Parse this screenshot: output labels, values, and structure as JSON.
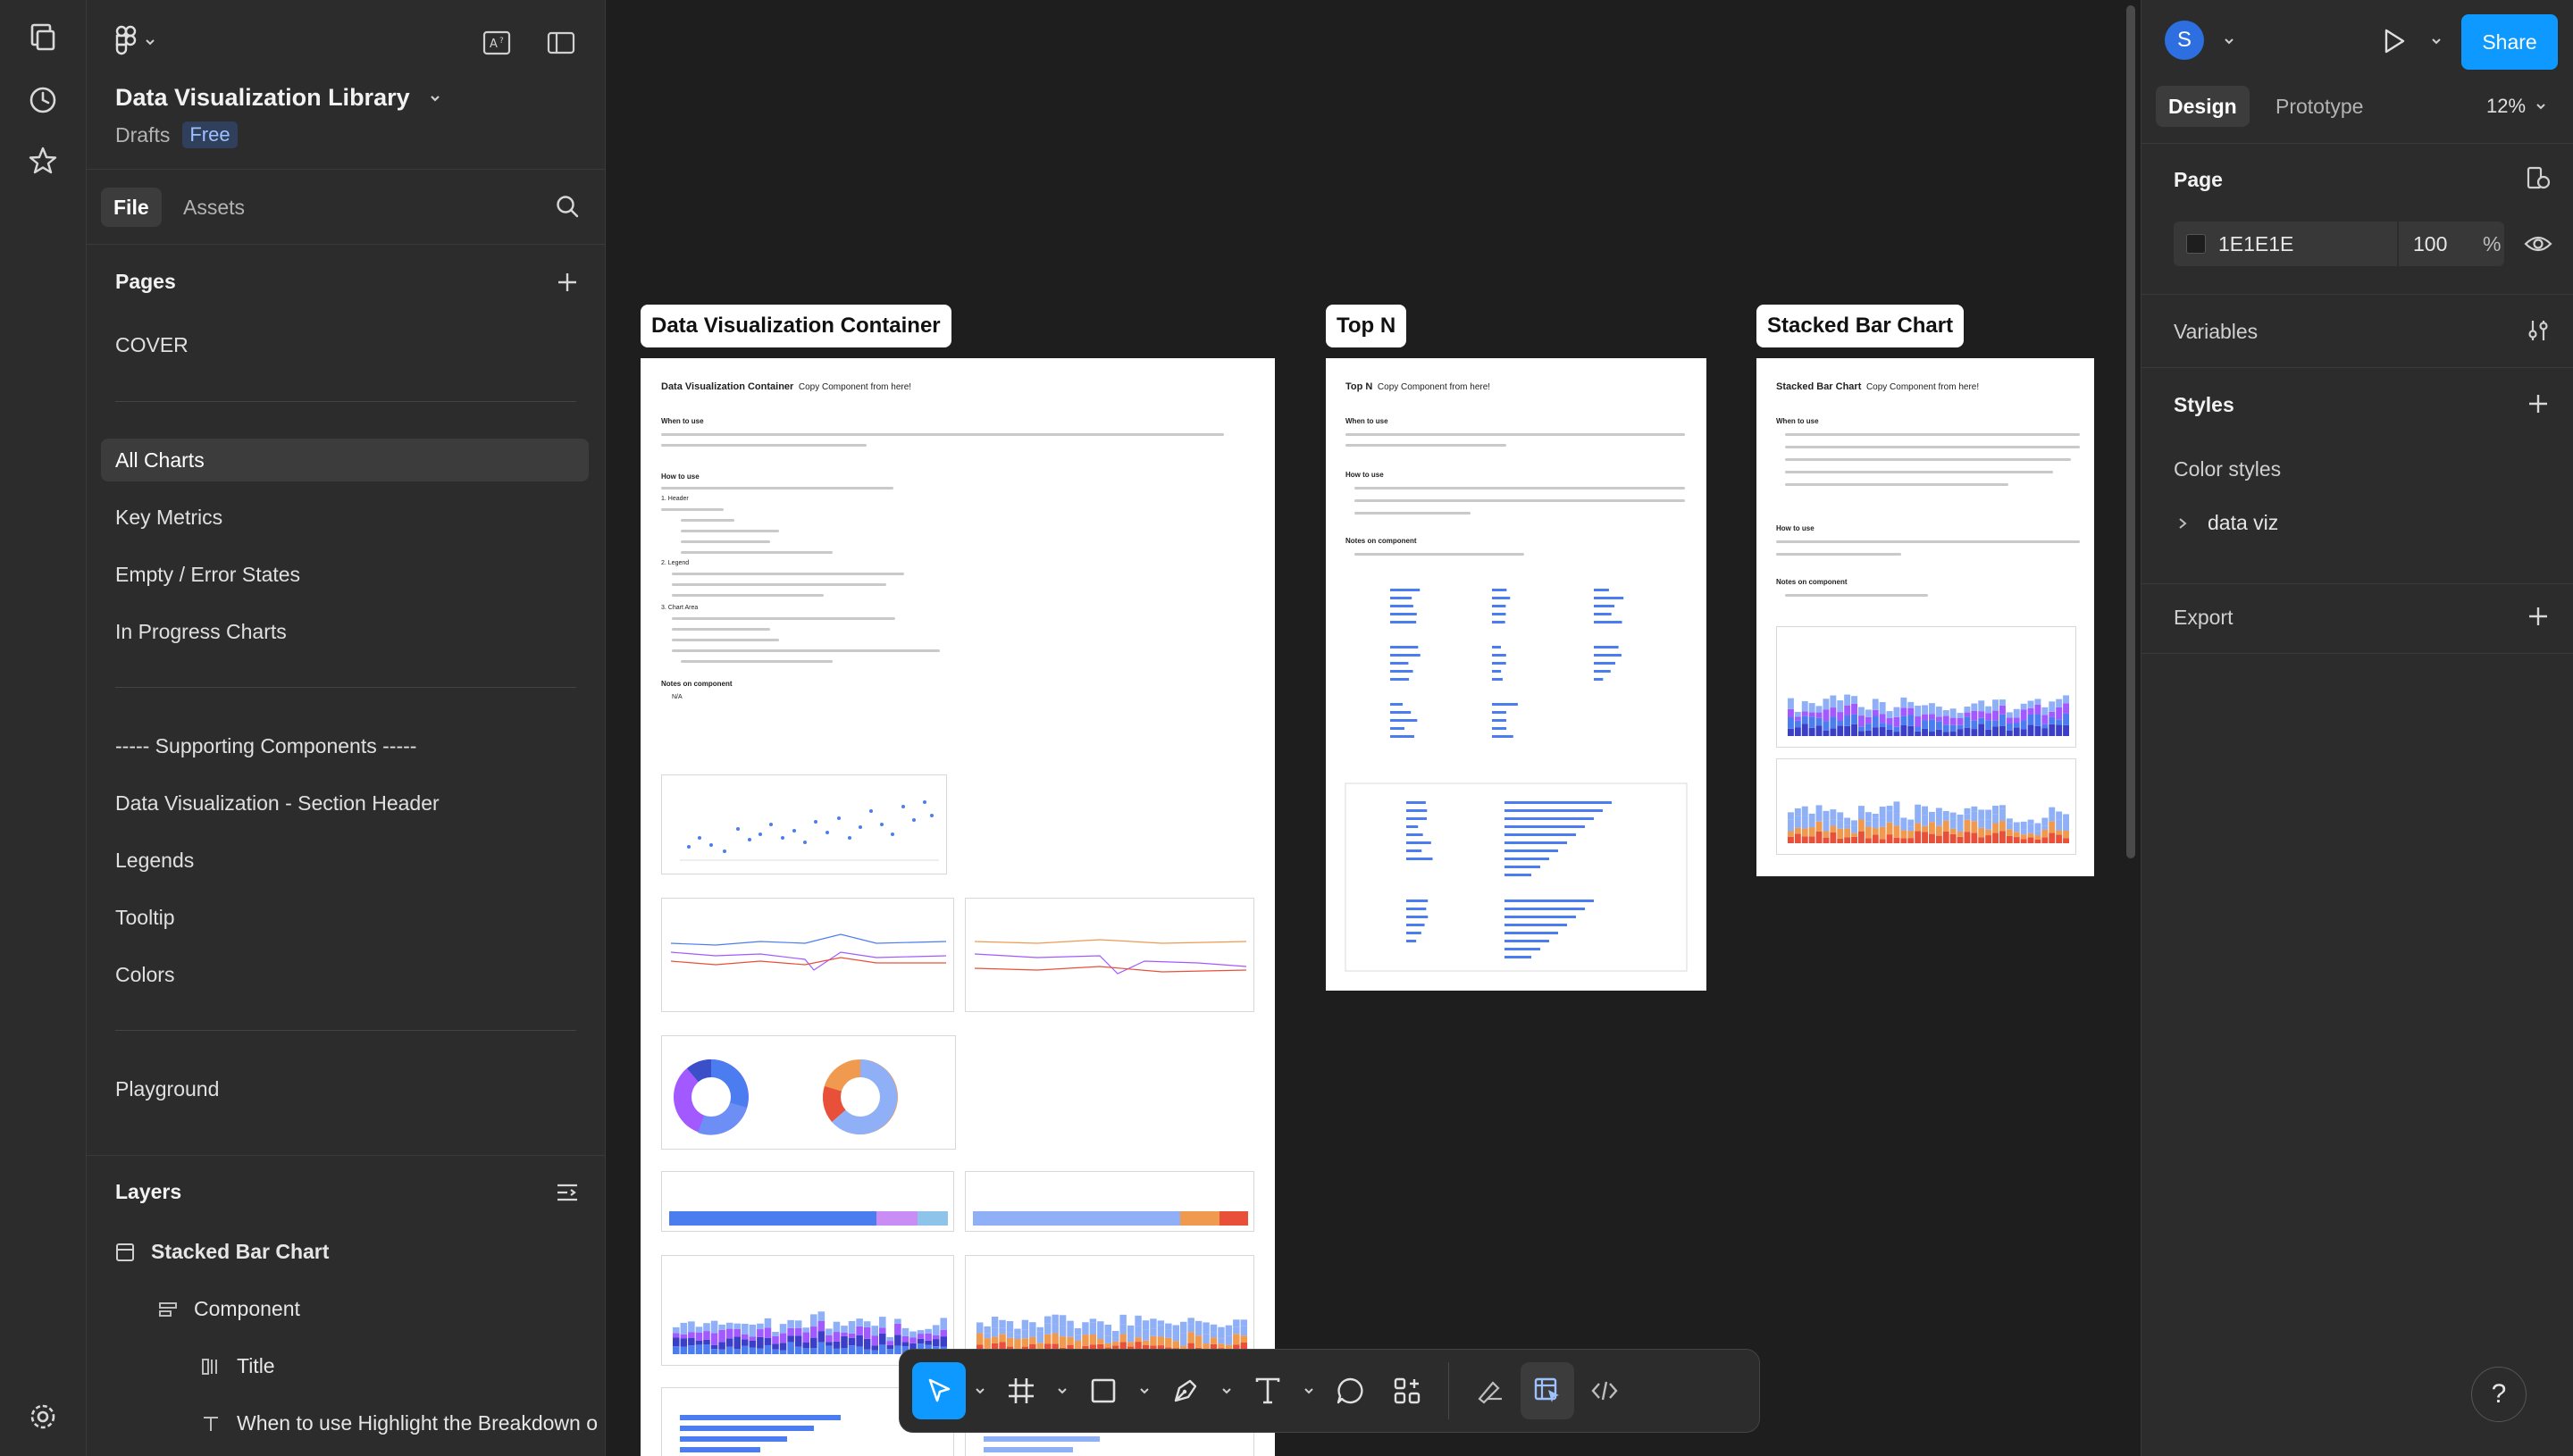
{
  "file": {
    "title": "Data Visualization Library",
    "location": "Drafts",
    "plan_badge": "Free"
  },
  "left_tabs": {
    "file": "File",
    "assets": "Assets"
  },
  "pages": {
    "heading": "Pages",
    "items": [
      "COVER",
      "All Charts",
      "Key Metrics",
      "Empty / Error States",
      "In Progress Charts",
      "----- Supporting Components -----",
      "Data Visualization - Section Header",
      "Legends",
      "Tooltip",
      "Colors",
      "Playground"
    ],
    "active": "All Charts"
  },
  "layers": {
    "heading": "Layers",
    "items": [
      "Stacked Bar Chart",
      "Component",
      "Title",
      "When to use Highlight the Breakdown o"
    ]
  },
  "canvas": {
    "frames": [
      {
        "label": "Data Visualization Container",
        "doc_title": "Data Visualization Container",
        "doc_note": "Copy Component from here!",
        "sections": [
          "When to use",
          "How to use",
          "1. Header",
          "2. Legend",
          "3. Chart Area",
          "Notes on component",
          "N/A"
        ]
      },
      {
        "label": "Top N",
        "doc_title": "Top N",
        "doc_note": "Copy Component from here!",
        "sections": [
          "When to use",
          "How to use",
          "Notes on component"
        ]
      },
      {
        "label": "Stacked Bar Chart",
        "doc_title": "Stacked Bar Chart",
        "doc_note": "Copy Component from here!",
        "sections": [
          "When to use",
          "How to use",
          "Notes on component"
        ]
      }
    ]
  },
  "right": {
    "avatar_initial": "S",
    "share_label": "Share",
    "tabs": {
      "design": "Design",
      "prototype": "Prototype"
    },
    "zoom": "12%",
    "page": {
      "heading": "Page",
      "bg_hex": "1E1E1E",
      "opacity": "100",
      "opacity_unit": "%"
    },
    "variables_heading": "Variables",
    "styles_heading": "Styles",
    "color_styles_heading": "Color styles",
    "color_style_group": "data viz",
    "export_heading": "Export"
  },
  "help_label": "?",
  "colors": {
    "accent": "#0d99ff",
    "panel": "#2c2c2c",
    "canvas": "#1e1e1e",
    "chart_blue": "#4c7df0",
    "chart_purple": "#a259ff",
    "chart_orange": "#f09a50",
    "chart_red": "#e8503a"
  }
}
